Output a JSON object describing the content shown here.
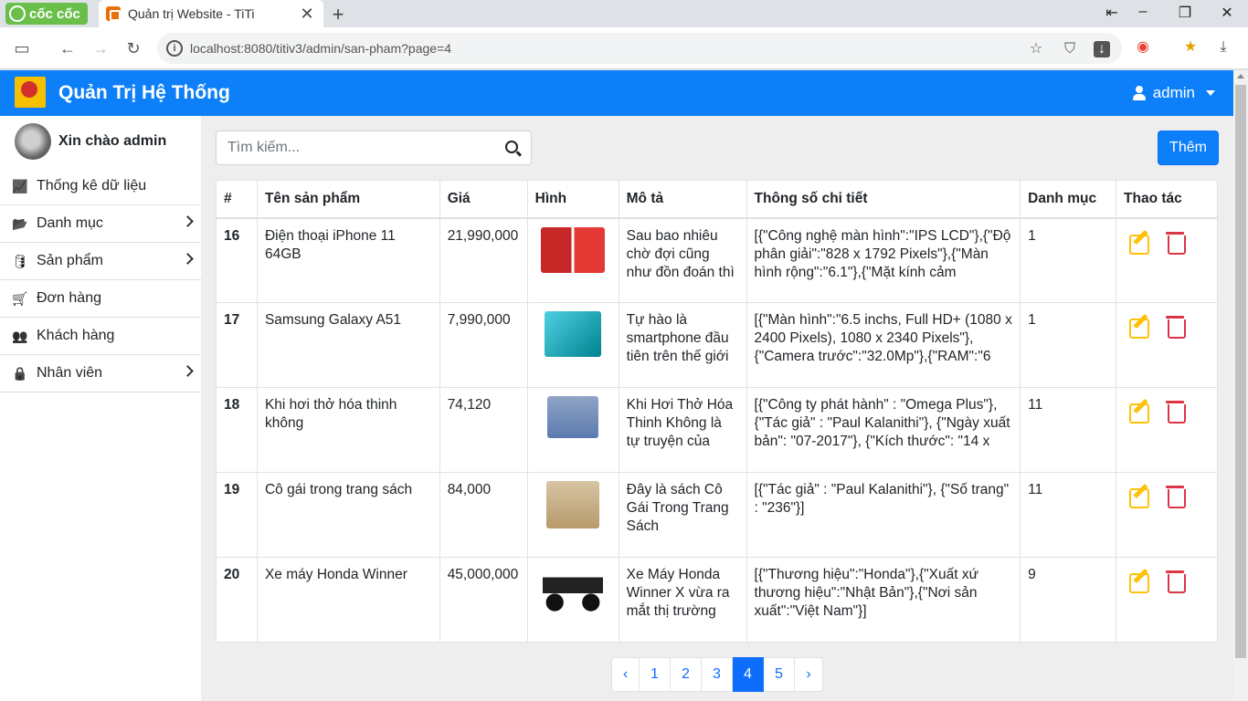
{
  "browser": {
    "brand": "cốc cốc",
    "tab_title": "Quản trị Website - TiTi",
    "url": "localhost:8080/titiv3/admin/san-pham?page=4"
  },
  "header": {
    "title": "Quản Trị Hệ Thống",
    "user": "admin"
  },
  "sidebar": {
    "greeting": "Xin chào admin",
    "items": [
      {
        "label": "Thống kê dữ liệu",
        "icon": "chart-line-icon",
        "has_submenu": false
      },
      {
        "label": "Danh mục",
        "icon": "folder-icon",
        "has_submenu": true
      },
      {
        "label": "Sản phẩm",
        "icon": "database-icon",
        "has_submenu": true
      },
      {
        "label": "Đơn hàng",
        "icon": "cart-icon",
        "has_submenu": false
      },
      {
        "label": "Khách hàng",
        "icon": "users-icon",
        "has_submenu": false
      },
      {
        "label": "Nhân viên",
        "icon": "user-lock-icon",
        "has_submenu": true
      }
    ]
  },
  "toolbar": {
    "search_placeholder": "Tìm kiếm...",
    "add_label": "Thêm"
  },
  "table": {
    "columns": [
      "#",
      "Tên sản phẩm",
      "Giá",
      "Hình",
      "Mô tả",
      "Thông số chi tiết",
      "Danh mục",
      "Thao tác"
    ],
    "rows": [
      {
        "id": "16",
        "name": "Điện thoại iPhone 11 64GB",
        "price": "21,990,000",
        "image": "iphone-red",
        "desc": "Sau bao nhiêu chờ đợi cũng như đồn đoán thì",
        "spec": "[{\"Công nghệ màn hình\":\"IPS LCD\"},{\"Độ phân giải\":\"828 x 1792 Pixels\"},{\"Màn hình rộng\":\"6.1\"},{\"Mặt kính cảm",
        "category": "1"
      },
      {
        "id": "17",
        "name": "Samsung Galaxy A51",
        "price": "7,990,000",
        "image": "galaxy-teal",
        "desc": "Tự hào là smartphone đầu tiên trên thế giới",
        "spec": "[{\"Màn hình\":\"6.5 inchs, Full HD+ (1080 x 2400 Pixels), 1080 x 2340 Pixels\"},{\"Camera trước\":\"32.0Mp\"},{\"RAM\":\"6",
        "category": "1"
      },
      {
        "id": "18",
        "name": "Khi hơi thở hóa thinh không",
        "price": "74,120",
        "image": "book-blue",
        "desc": "Khi Hơi Thở Hóa Thinh Không là tự truyện của",
        "spec": "[{\"Công ty phát hành\" : \"Omega Plus\"}, {\"Tác giả\" : \"Paul Kalanithi\"}, {\"Ngày xuất bản\": \"07-2017\"}, {\"Kích thước\": \"14 x",
        "category": "11"
      },
      {
        "id": "19",
        "name": "Cô gái trong trang sách",
        "price": "84,000",
        "image": "book-beige",
        "desc": "Đây là sách Cô Gái Trong Trang Sách",
        "spec": "[{\"Tác giả\" : \"Paul Kalanithi\"}, {\"Số trang\" : \"236\"}]",
        "category": "11"
      },
      {
        "id": "20",
        "name": "Xe máy Honda Winner",
        "price": "45,000,000",
        "image": "motorbike",
        "desc": "Xe Máy Honda Winner X vừa ra mắt thị trường",
        "spec": "[{\"Thương hiệu\":\"Honda\"},{\"Xuất xứ thương hiệu\":\"Nhật Bản\"},{\"Nơi sản xuất\":\"Việt Nam\"}]",
        "category": "9"
      }
    ]
  },
  "pagination": {
    "prev": "‹",
    "pages": [
      "1",
      "2",
      "3",
      "4",
      "5"
    ],
    "current": "4",
    "next": "›"
  },
  "colors": {
    "primary": "#0d7ff8",
    "edit": "#ffc107",
    "delete": "#dc3545"
  }
}
